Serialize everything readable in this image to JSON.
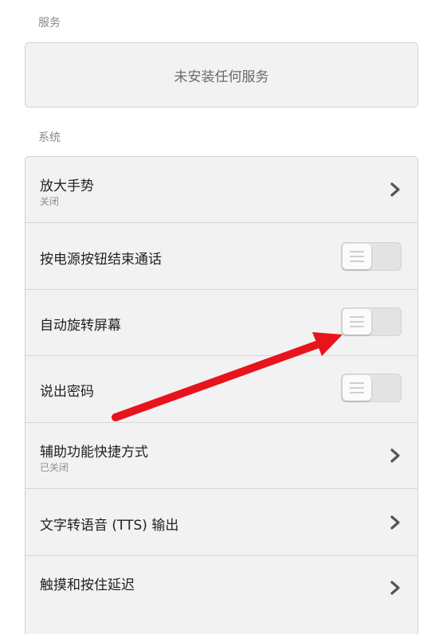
{
  "services": {
    "label": "服务",
    "empty_text": "未安装任何服务"
  },
  "system": {
    "label": "系统",
    "items": [
      {
        "title": "放大手势",
        "subtitle": "关闭",
        "control": "chevron"
      },
      {
        "title": "按电源按钮结束通话",
        "control": "toggle",
        "on": false
      },
      {
        "title": "自动旋转屏幕",
        "control": "toggle",
        "on": false
      },
      {
        "title": "说出密码",
        "control": "toggle",
        "on": false
      },
      {
        "title": "辅助功能快捷方式",
        "subtitle": "已关闭",
        "control": "chevron"
      },
      {
        "title": "文字转语音 (TTS) 输出",
        "control": "chevron"
      },
      {
        "title": "触摸和按住延迟",
        "control": "chevron"
      }
    ]
  },
  "colors": {
    "annotation_arrow": "#e8141b",
    "card_background": "#f2f2f2"
  }
}
